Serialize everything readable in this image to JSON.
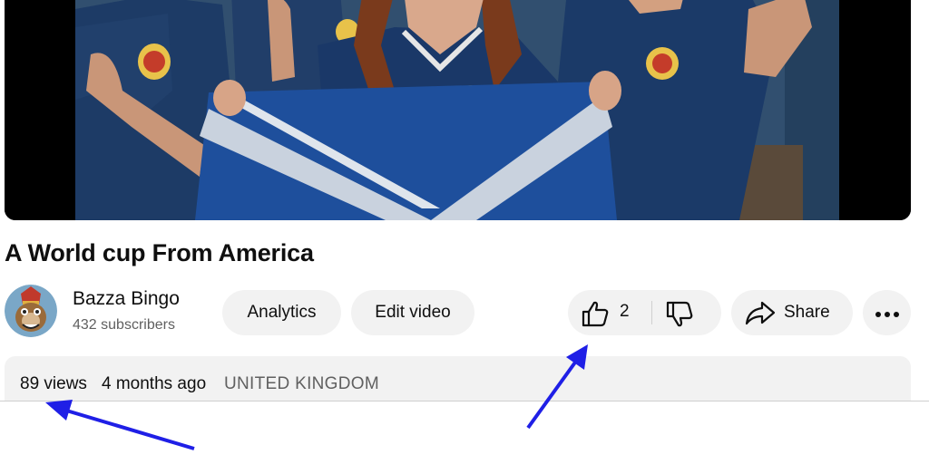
{
  "video": {
    "title": "A World cup From America"
  },
  "channel": {
    "name": "Bazza Bingo",
    "subscribers": "432 subscribers"
  },
  "actions": {
    "analytics_label": "Analytics",
    "edit_label": "Edit video",
    "like_count": "2",
    "share_label": "Share"
  },
  "description": {
    "views": "89 views",
    "age": "4 months ago",
    "location": "UNITED KINGDOM"
  },
  "icons": [
    "thumbs-up-icon",
    "thumbs-down-icon",
    "share-icon",
    "more-icon",
    "channel-avatar"
  ],
  "colors": {
    "annotation_arrow": "#1f1fe6",
    "pill_bg": "#f2f2f2",
    "secondary_text": "#606060",
    "jersey_navy": "#1c3a6b",
    "flag_blue": "#1e4f9c"
  }
}
